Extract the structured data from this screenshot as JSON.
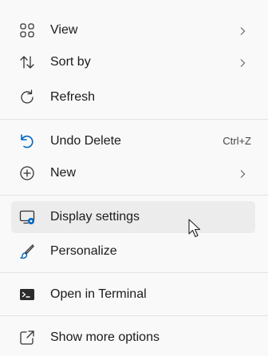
{
  "menu": {
    "items": [
      {
        "label": "View",
        "icon": "view-grid-icon",
        "has_submenu": true
      },
      {
        "label": "Sort by",
        "icon": "sort-arrows-icon",
        "has_submenu": true
      },
      {
        "label": "Refresh",
        "icon": "refresh-icon",
        "has_submenu": false
      },
      {
        "label": "Undo Delete",
        "icon": "undo-icon",
        "shortcut": "Ctrl+Z"
      },
      {
        "label": "New",
        "icon": "add-circle-icon",
        "has_submenu": true
      },
      {
        "label": "Display settings",
        "icon": "display-settings-icon",
        "hovered": true
      },
      {
        "label": "Personalize",
        "icon": "brush-icon"
      },
      {
        "label": "Open in Terminal",
        "icon": "terminal-icon"
      },
      {
        "label": "Show more options",
        "icon": "share-open-icon"
      }
    ]
  },
  "colors": {
    "menu_background": "#f9f9f9",
    "hover_background": "#ececec",
    "accent_blue": "#0067c0",
    "text": "#1b1b1b"
  }
}
